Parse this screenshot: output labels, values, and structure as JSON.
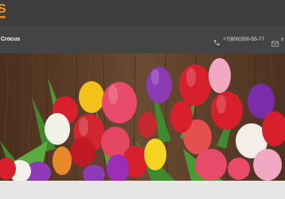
{
  "header": {
    "logo_mark": "S",
    "brand": "Crocus",
    "phone": "+7(800)550-55-77",
    "email": "s"
  },
  "hero": {
    "image": "tulip-bouquet-on-wooden-background"
  },
  "colors": {
    "topbar": "#3e3e3e",
    "subbar": "#444444",
    "accent": "#f39a1f",
    "background": "#e9e9e9"
  }
}
